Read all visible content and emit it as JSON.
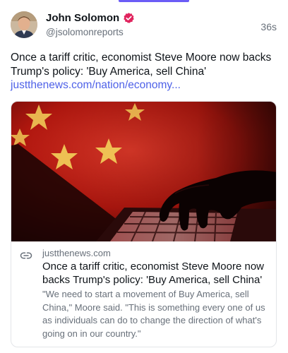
{
  "post": {
    "author_name": "John Solomon",
    "author_handle": "@jsolomonreports",
    "timestamp": "36s",
    "text": "Once a tariff critic, economist Steve Moore now backs Trump's policy: 'Buy America, sell China'",
    "text_link": "justthenews.com/nation/economy...",
    "verified_badge_color": "#e0245e"
  },
  "card": {
    "domain": "justthenews.com",
    "title": "Once a tariff critic, economist Steve Moore now backs Trump's policy: 'Buy America, sell China'",
    "description": "\"We need to start a movement of Buy America, sell China,\" Moore said. \"This is something every one of us as individuals can do to change the direction of what's going on in our country.\""
  },
  "colors": {
    "accent": "#6b5cf6",
    "link": "#4f62e8",
    "muted_text": "#68707a"
  }
}
